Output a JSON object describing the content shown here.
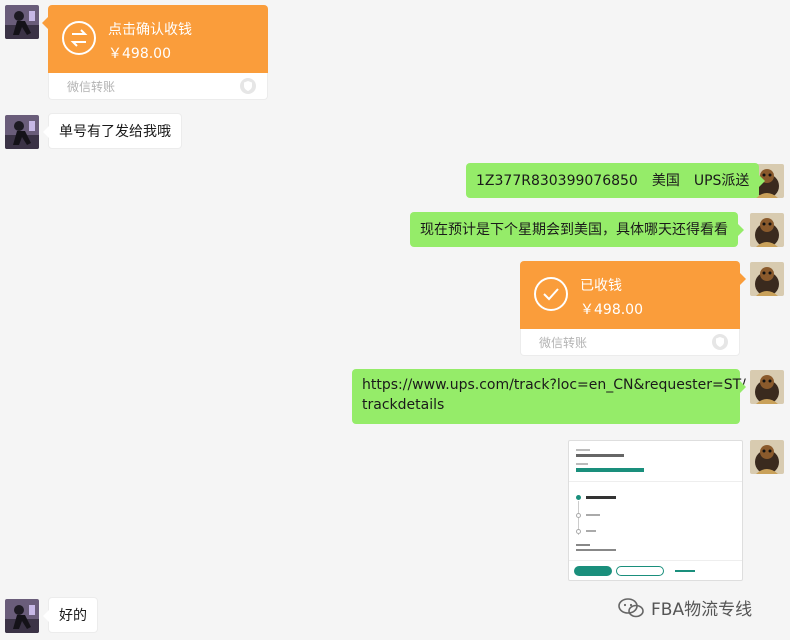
{
  "colors": {
    "background": "#f5f5f5",
    "sent_bubble": "#95ec69",
    "received_bubble": "#ffffff",
    "transfer_orange": "#fa9d3b"
  },
  "messages": [
    {
      "side": "left",
      "type": "transfer",
      "title": "点击确认收钱",
      "amount": "￥498.00",
      "footer": "微信转账",
      "icon": "transfer-arrows-icon"
    },
    {
      "side": "left",
      "type": "text",
      "text": "单号有了发给我哦"
    },
    {
      "side": "right",
      "type": "text",
      "text": "1Z377R830399076850　美国　UPS派送"
    },
    {
      "side": "right",
      "type": "text",
      "text": "现在预计是下个星期会到美国，具体哪天还得看看"
    },
    {
      "side": "right",
      "type": "transfer",
      "title": "已收钱",
      "amount": "￥498.00",
      "footer": "微信转账",
      "icon": "check-icon"
    },
    {
      "side": "right",
      "type": "link",
      "text": "https://www.ups.com/track?loc=en_CN&requester=ST/trackdetails",
      "line1": "https://www.ups.com/track?loc=en_CN&requester=ST/",
      "line2": "trackdetails"
    },
    {
      "side": "right",
      "type": "image"
    },
    {
      "side": "left",
      "type": "text",
      "text": "好的"
    }
  ],
  "watermark": {
    "text": "FBA物流专线",
    "icon": "wechat-official-account-icon"
  }
}
